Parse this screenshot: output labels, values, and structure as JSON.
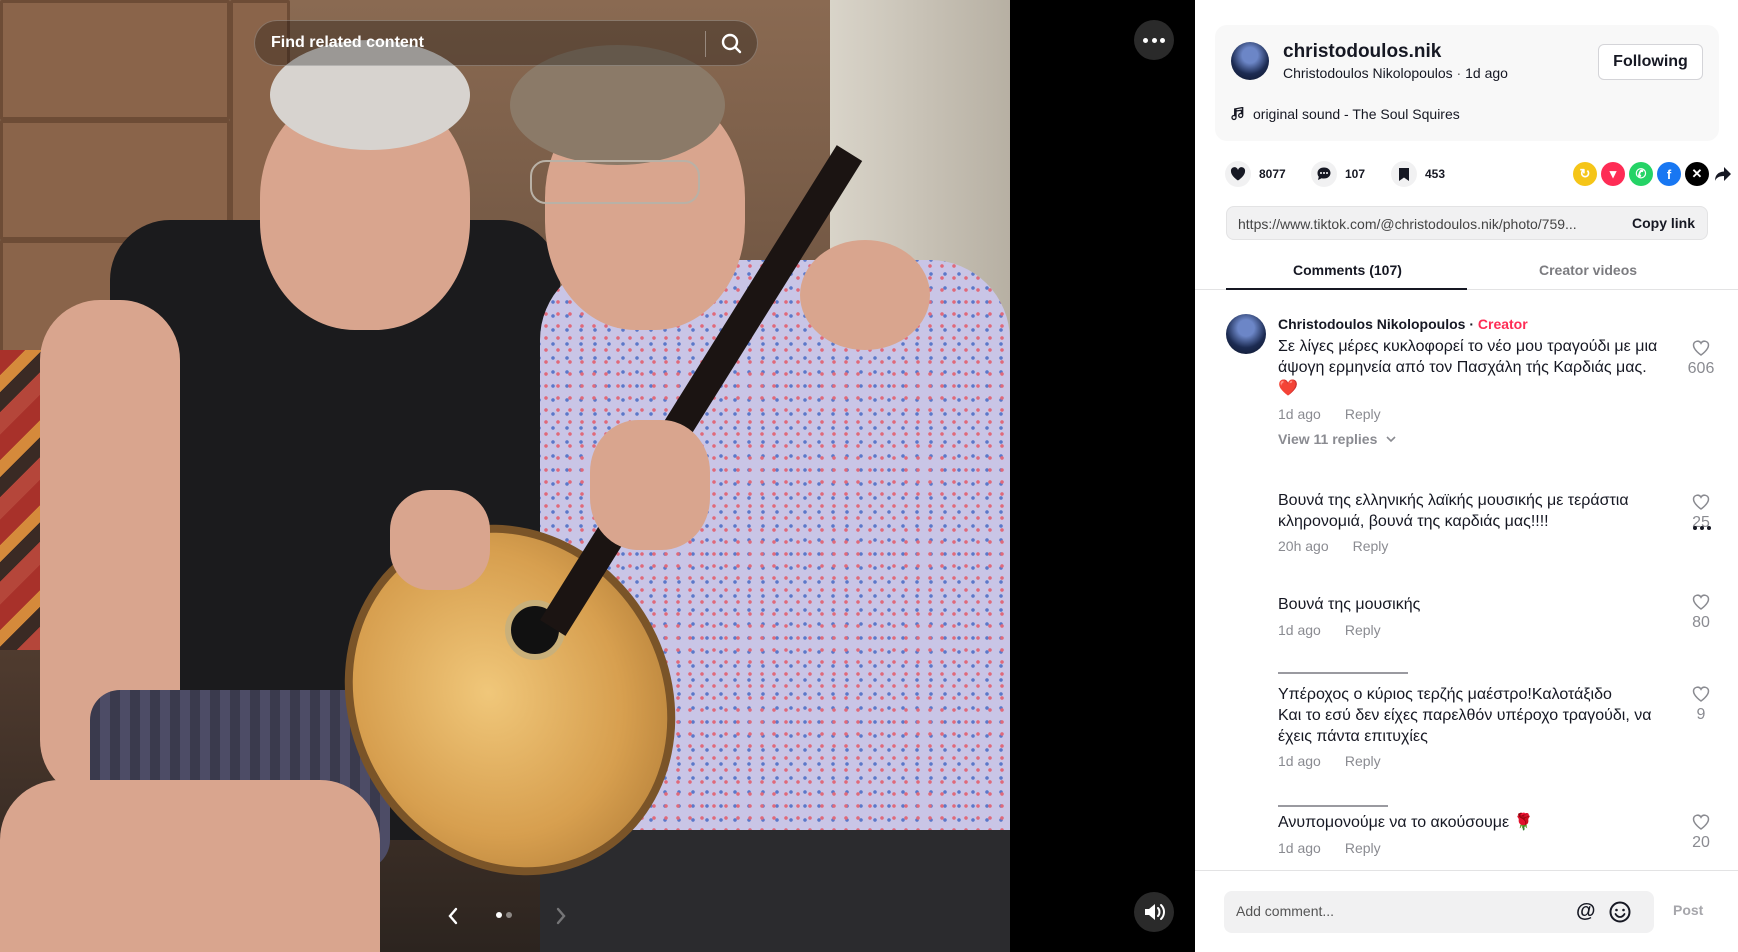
{
  "media": {
    "search_placeholder": "Find related content",
    "photo_alt": "Two men sitting together, one holding a bouzouki",
    "pager": {
      "current": 1,
      "total": 2
    },
    "icons": {
      "more": "more-horizontal-icon",
      "sound": "volume-icon",
      "search": "search-icon"
    }
  },
  "creator": {
    "handle": "christodoulos.nik",
    "display_name": "Christodoulos Nikolopoulos",
    "separator": " · ",
    "posted": "1d ago",
    "follow_label": "Following",
    "music": "original sound - The Soul Squires"
  },
  "stats": {
    "likes": "8077",
    "comments": "107",
    "saves": "453"
  },
  "share": {
    "colors": {
      "repost": "#f5c518",
      "tiktok_share": "#fe2c55",
      "whatsapp": "#25d366",
      "facebook": "#1877f2",
      "x": "#000000"
    }
  },
  "link": {
    "url": "https://www.tiktok.com/@christodoulos.nik/photo/759...",
    "copy_label": "Copy link"
  },
  "tabs": {
    "comments": "Comments (107)",
    "creator_videos": "Creator videos"
  },
  "comments": [
    {
      "author": "Christodoulos Nikolopoulos",
      "badge": "Creator",
      "badge_sep": " · ",
      "text": "Σε λίγες μέρες κυκλοφορεί το νέο μου τραγούδι με μια άψογη ερμηνεία από τον Πασχάλη τής Καρδιάς μας.\n❤️",
      "time": "1d ago",
      "reply": "Reply",
      "likes": "606",
      "view_replies": "View 11 replies"
    },
    {
      "text": "Βουνά της ελληνικής λαϊκής μουσικής με τεράστια κληρονομιά, βουνά της καρδιάς μας!!!!",
      "time": "20h ago",
      "reply": "Reply",
      "likes": "25"
    },
    {
      "text": "Βουνά της μουσικής",
      "time": "1d ago",
      "reply": "Reply",
      "likes": "80"
    },
    {
      "text": "Υπέροχος ο κύριος τερζής μαέστρο!Καλοτάξιδο\nΚαι το εσύ δεν είχες παρελθόν υπέροχο τραγούδι, να έχεις πάντα επιτυχίες",
      "time": "1d ago",
      "reply": "Reply",
      "likes": "9"
    },
    {
      "text": "Ανυπομονούμε να το ακούσουμε 🌹",
      "time": "1d ago",
      "reply": "Reply",
      "likes": "20"
    }
  ],
  "composer": {
    "placeholder": "Add comment...",
    "post_label": "Post"
  }
}
